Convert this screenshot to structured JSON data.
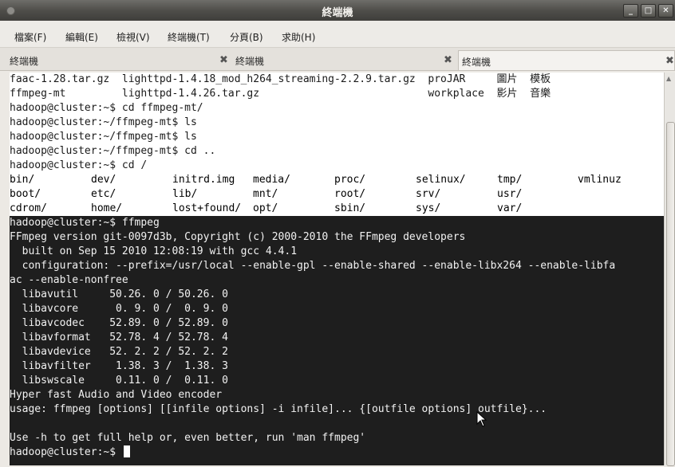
{
  "window": {
    "title": "終端機"
  },
  "menu": [
    "檔案(F)",
    "編輯(E)",
    "檢視(V)",
    "終端機(T)",
    "分頁(B)",
    "求助(H)"
  ],
  "tabs": [
    {
      "label": "終端機",
      "close": "✖"
    },
    {
      "label": "終端機",
      "close": "✖"
    },
    {
      "label": "終端機",
      "close": "✖"
    }
  ],
  "window_buttons": {
    "minimize": "_",
    "maximize": "□",
    "close": "✕"
  },
  "terminal": {
    "top_lines": [
      "faac-1.28.tar.gz  lighttpd-1.4.18_mod_h264_streaming-2.2.9.tar.gz  proJAR     圖片  模板",
      "ffmpeg-mt         lighttpd-1.4.26.tar.gz                           workplace  影片  音樂",
      "hadoop@cluster:~$ cd ffmpeg-mt/",
      "hadoop@cluster:~/ffmpeg-mt$ ls",
      "hadoop@cluster:~/ffmpeg-mt$ ls",
      "hadoop@cluster:~/ffmpeg-mt$ cd ..",
      "hadoop@cluster:~$ cd /"
    ],
    "ls_rows": [
      [
        "bin/",
        "dev/",
        "initrd.img",
        "media/",
        "proc/",
        "selinux/",
        "tmp/",
        "vmlinuz"
      ],
      [
        "boot/",
        "etc/",
        "lib/",
        "mnt/",
        "root/",
        "srv/",
        "usr/",
        ""
      ],
      [
        "cdrom/",
        "home/",
        "lost+found/",
        "opt/",
        "sbin/",
        "sys/",
        "var/",
        ""
      ]
    ],
    "dark_lines": [
      "hadoop@cluster:~$ ffmpeg",
      "FFmpeg version git-0097d3b, Copyright (c) 2000-2010 the FFmpeg developers",
      "  built on Sep 15 2010 12:08:19 with gcc 4.4.1",
      "  configuration: --prefix=/usr/local --enable-gpl --enable-shared --enable-libx264 --enable-libfa",
      "ac --enable-nonfree",
      "  libavutil     50.26. 0 / 50.26. 0",
      "  libavcore      0. 9. 0 /  0. 9. 0",
      "  libavcodec    52.89. 0 / 52.89. 0",
      "  libavformat   52.78. 4 / 52.78. 4",
      "  libavdevice   52. 2. 2 / 52. 2. 2",
      "  libavfilter    1.38. 3 /  1.38. 3",
      "  libswscale     0.11. 0 /  0.11. 0",
      "Hyper fast Audio and Video encoder",
      "usage: ffmpeg [options] [[infile options] -i infile]... {[outfile options] outfile}...",
      "",
      "Use -h to get full help or, even better, run 'man ffmpeg'"
    ],
    "prompt": "hadoop@cluster:~$ "
  }
}
